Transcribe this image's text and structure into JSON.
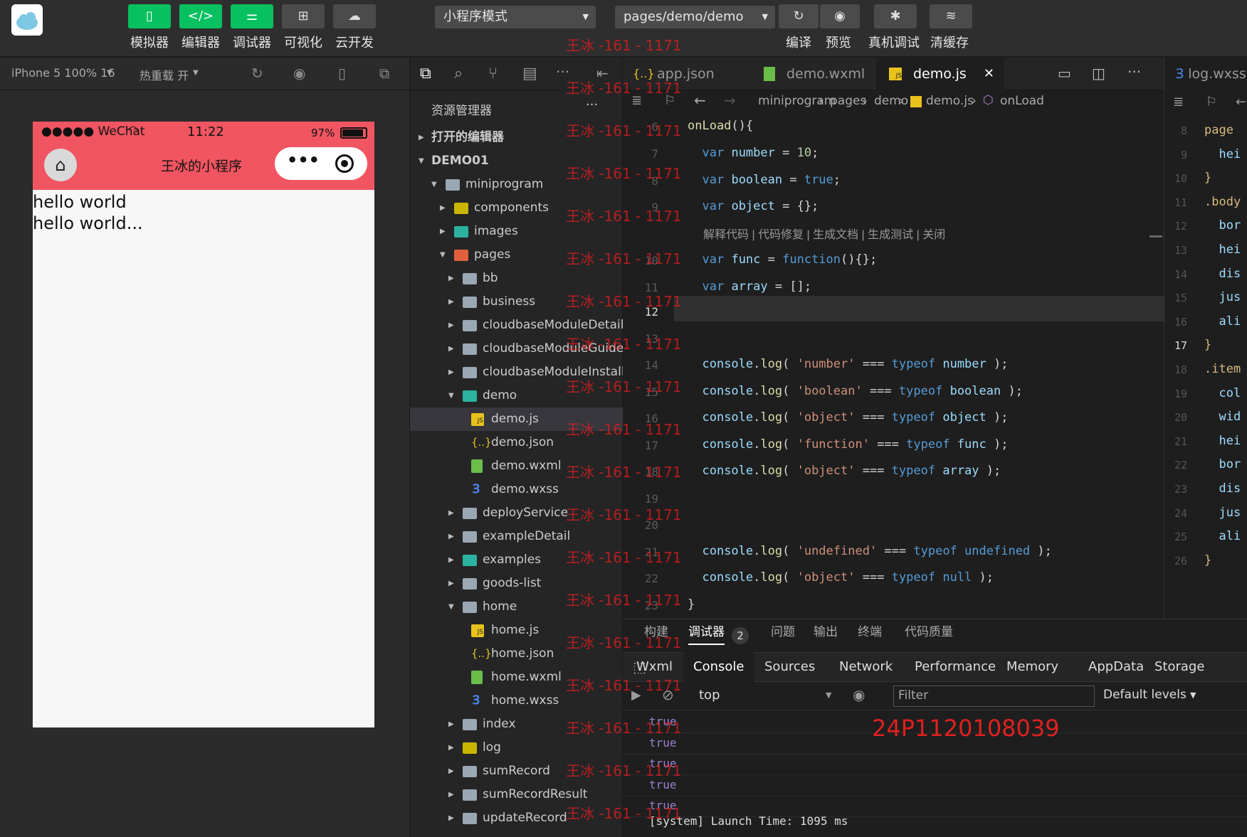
{
  "toolbar": {
    "buttons": [
      {
        "label": "模拟器",
        "icon": "phone-icon",
        "glyph": "▯"
      },
      {
        "label": "编辑器",
        "icon": "code-icon",
        "glyph": "</>"
      },
      {
        "label": "调试器",
        "icon": "sliders-icon",
        "glyph": "⚌"
      },
      {
        "label": "可视化",
        "icon": "layout-icon",
        "glyph": "⊞"
      },
      {
        "label": "云开发",
        "icon": "cloud-icon",
        "glyph": "☁"
      }
    ],
    "mode": "小程序模式",
    "page_path": "pages/demo/demo",
    "right_buttons": [
      {
        "label": "编译",
        "glyph": "↻"
      },
      {
        "label": "预览",
        "glyph": "◉"
      },
      {
        "label": "真机调试",
        "glyph": "✱"
      },
      {
        "label": "清缓存",
        "glyph": "≋"
      }
    ]
  },
  "simulator": {
    "device": "iPhone 5 100% 16",
    "hot_reload": "热重载 开",
    "status_carrier": "●●●●● WeChat",
    "status_time": "11:22",
    "status_battery": "97%",
    "nav_title": "王冰的小程序",
    "capsule_more": "•••",
    "content": [
      "hello world",
      "hello world..."
    ]
  },
  "explorer": {
    "title": "资源管理器",
    "more": "···",
    "open_editors": "打开的编辑器",
    "project": "DEMO01",
    "tree": [
      {
        "name": "miniprogram",
        "depth": 0,
        "arrow": "▼",
        "icon": "folder-open"
      },
      {
        "name": "components",
        "depth": 1,
        "arrow": "▶",
        "icon": "folder-yellow"
      },
      {
        "name": "images",
        "depth": 1,
        "arrow": "▶",
        "icon": "folder-teal"
      },
      {
        "name": "pages",
        "depth": 1,
        "arrow": "▼",
        "icon": "folder-red"
      },
      {
        "name": "bb",
        "depth": 2,
        "arrow": "▶",
        "icon": "folder"
      },
      {
        "name": "business",
        "depth": 2,
        "arrow": "▶",
        "icon": "folder"
      },
      {
        "name": "cloudbaseModuleDetail",
        "depth": 2,
        "arrow": "▶",
        "icon": "folder"
      },
      {
        "name": "cloudbaseModuleGuide",
        "depth": 2,
        "arrow": "▶",
        "icon": "folder"
      },
      {
        "name": "cloudbaseModuleInstall...",
        "depth": 2,
        "arrow": "▶",
        "icon": "folder"
      },
      {
        "name": "demo",
        "depth": 2,
        "arrow": "▼",
        "icon": "folder-teal"
      },
      {
        "name": "demo.js",
        "depth": 3,
        "arrow": "",
        "icon": "js",
        "selected": true
      },
      {
        "name": "demo.json",
        "depth": 3,
        "arrow": "",
        "icon": "json"
      },
      {
        "name": "demo.wxml",
        "depth": 3,
        "arrow": "",
        "icon": "wxml"
      },
      {
        "name": "demo.wxss",
        "depth": 3,
        "arrow": "",
        "icon": "wxss"
      },
      {
        "name": "deployService",
        "depth": 2,
        "arrow": "▶",
        "icon": "folder"
      },
      {
        "name": "exampleDetail",
        "depth": 2,
        "arrow": "▶",
        "icon": "folder"
      },
      {
        "name": "examples",
        "depth": 2,
        "arrow": "▶",
        "icon": "folder-teal"
      },
      {
        "name": "goods-list",
        "depth": 2,
        "arrow": "▶",
        "icon": "folder"
      },
      {
        "name": "home",
        "depth": 2,
        "arrow": "▼",
        "icon": "folder-open"
      },
      {
        "name": "home.js",
        "depth": 3,
        "arrow": "",
        "icon": "js"
      },
      {
        "name": "home.json",
        "depth": 3,
        "arrow": "",
        "icon": "json"
      },
      {
        "name": "home.wxml",
        "depth": 3,
        "arrow": "",
        "icon": "wxml"
      },
      {
        "name": "home.wxss",
        "depth": 3,
        "arrow": "",
        "icon": "wxss"
      },
      {
        "name": "index",
        "depth": 2,
        "arrow": "▶",
        "icon": "folder"
      },
      {
        "name": "log",
        "depth": 2,
        "arrow": "▶",
        "icon": "folder-yellow"
      },
      {
        "name": "sumRecord",
        "depth": 2,
        "arrow": "▶",
        "icon": "folder"
      },
      {
        "name": "sumRecordResult",
        "depth": 2,
        "arrow": "▶",
        "icon": "folder"
      },
      {
        "name": "updateRecord",
        "depth": 2,
        "arrow": "▶",
        "icon": "folder"
      }
    ]
  },
  "editor": {
    "tabs": [
      {
        "label": "app.json",
        "icon": "{..}",
        "active": false
      },
      {
        "label": "demo.wxml",
        "icon": "wxml",
        "active": false
      },
      {
        "label": "demo.js",
        "icon": "JS",
        "active": true
      }
    ],
    "close": "✕",
    "breadcrumb": [
      "miniprogram",
      "pages",
      "demo",
      "demo.js",
      "onLoad"
    ],
    "codelens": "解释代码 | 代码修复 | 生成文档 | 生成测试 | 关闭",
    "right_tab": "log.wxss"
  },
  "debugger": {
    "tabs": [
      "构建",
      "调试器",
      "问题",
      "输出",
      "终端",
      "代码质量"
    ],
    "badge": "2",
    "devtabs": [
      "Wxml",
      "Console",
      "Sources",
      "Network",
      "Performance",
      "Memory",
      "AppData",
      "Storage"
    ],
    "context": "top",
    "filter_placeholder": "Filter",
    "levels": "Default levels",
    "logs": [
      "true",
      "true",
      "true",
      "true",
      "true"
    ],
    "system": "[system] Launch Time: 1095 ms",
    "watermark_code": "24P1120108039"
  },
  "watermark": "王冰 -161 - 1171",
  "colors": {
    "accent": "#07c160",
    "nav": "#f05561",
    "selection": "#37373d"
  }
}
